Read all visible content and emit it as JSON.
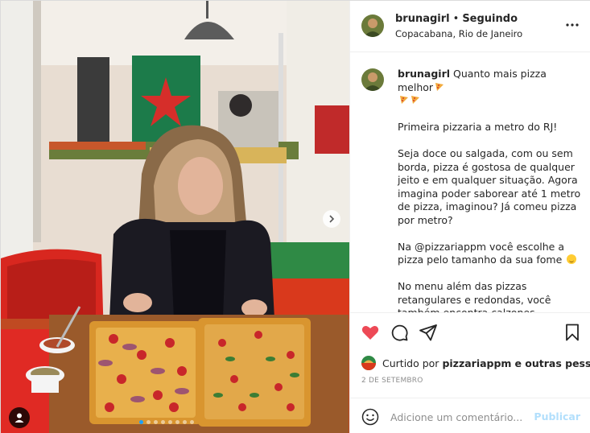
{
  "colors": {
    "like_red": "#ed4956",
    "link_disabled": "#b2dffc",
    "muted_text": "#8e8e8e",
    "carousel_active_dot": "#1aa0ff"
  },
  "post": {
    "image_alt": "",
    "carousel": {
      "total_slides": 8,
      "active_slide": 1
    },
    "icons": {
      "next": "chevron-right-icon",
      "tags": "user-tag-icon"
    }
  },
  "header": {
    "username": "brunagirl",
    "separator": "•",
    "follow_status": "Seguindo",
    "location": "Copacabana, Rio de Janeiro",
    "more_icon": "more-options-icon"
  },
  "caption": {
    "username": "brunagirl",
    "title": "Quanto mais pizza melhor",
    "paragraphs": [
      "Primeira pizzaria a metro do RJ!",
      "Seja doce ou salgada, com ou sem borda, pizza é gostosa de qualquer jeito e em qualquer situação. Agora imagina poder saborear até 1 metro de pizza, imaginou? Já comeu pizza por metro?",
      "Na @pizzariappm você escolhe a pizza pelo tamanho da sua fome",
      "No menu além das pizzas retangulares e redondas, você também encontra calzones, nhoques e fettuccines com molho à sua escolha."
    ]
  },
  "actions": {
    "like_icon": "heart-icon",
    "comment_icon": "comment-icon",
    "share_icon": "share-icon",
    "save_icon": "bookmark-icon",
    "liked": true
  },
  "likes": {
    "prefix": "Curtido por",
    "account": "pizzariappm",
    "suffix": "e outras pessoas"
  },
  "date": "2 DE SETEMBRO",
  "comment": {
    "emoji_icon": "emoji-icon",
    "placeholder": "Adicione um comentário...",
    "publish_label": "Publicar"
  }
}
